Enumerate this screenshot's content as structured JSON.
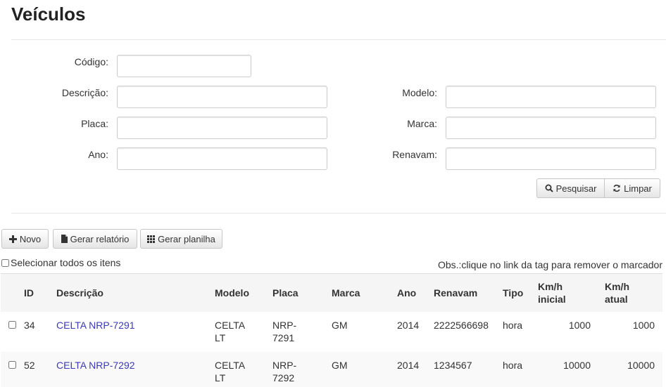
{
  "page": {
    "title": "Veículos"
  },
  "filters": {
    "codigo_label": "Código:",
    "descricao_label": "Descrição:",
    "placa_label": "Placa:",
    "ano_label": "Ano:",
    "modelo_label": "Modelo:",
    "marca_label": "Marca:",
    "renavam_label": "Renavam:",
    "codigo_value": "",
    "descricao_value": "",
    "placa_value": "",
    "ano_value": "",
    "modelo_value": "",
    "marca_value": "",
    "renavam_value": "",
    "search_label": "Pesquisar",
    "clear_label": "Limpar"
  },
  "toolbar": {
    "new_label": "Novo",
    "report_label": "Gerar relatório",
    "sheet_label": "Gerar planilha"
  },
  "list": {
    "select_all_label": "Selecionar todos os itens",
    "obs_text": "Obs.:clique no link da tag para remover o marcador",
    "columns": {
      "id": "ID",
      "descricao": "Descrição",
      "modelo": "Modelo",
      "placa": "Placa",
      "marca": "Marca",
      "ano": "Ano",
      "renavam": "Renavam",
      "tipo": "Tipo",
      "km_inicial_1": "Km/h",
      "km_inicial_2": "inicial",
      "km_atual_1": "Km/h",
      "km_atual_2": "atual"
    },
    "rows": [
      {
        "id": "34",
        "descricao": "CELTA NRP-7291",
        "modelo_1": "CELTA",
        "modelo_2": "LT",
        "placa_1": "NRP-",
        "placa_2": "7291",
        "marca": "GM",
        "ano": "2014",
        "renavam": "2222566698",
        "tipo": "hora",
        "km_inicial": "1000",
        "km_atual": "1000"
      },
      {
        "id": "52",
        "descricao": "CELTA NRP-7292",
        "modelo_1": "CELTA",
        "modelo_2": "LT",
        "placa_1": "NRP-",
        "placa_2": "7292",
        "marca": "GM",
        "ano": "2014",
        "renavam": "1234567",
        "tipo": "hora",
        "km_inicial": "10000",
        "km_atual": "10000"
      }
    ]
  }
}
